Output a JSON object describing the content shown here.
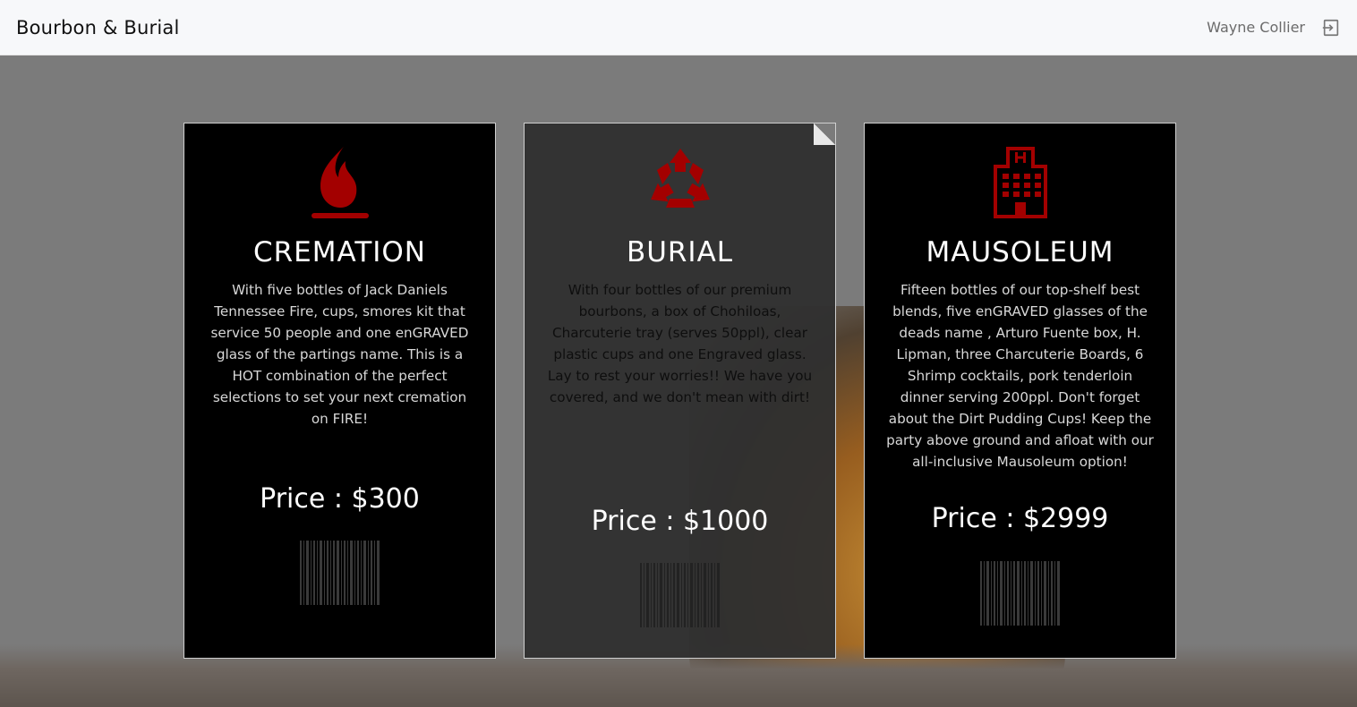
{
  "header": {
    "brand": "Bourbon & Burial",
    "user_name": "Wayne Collier",
    "logout_icon": "sign-out-icon"
  },
  "cards": [
    {
      "title": "CREMATION",
      "icon": "fire-icon",
      "description": "With five bottles of Jack Daniels Tennessee Fire, cups, smores kit that service 50 people and one enGRAVED glass of the partings name. This is a HOT combination of the perfect selections to set your next cremation on FIRE!",
      "price": "Price : $300"
    },
    {
      "title": "BURIAL",
      "icon": "recycle-icon",
      "description": "With four bottles of our premium bourbons, a box of Chohiloas, Charcuterie tray (serves 50ppl), clear plastic cups and one Engraved glass. Lay to rest your worries!! We have you covered, and we don't mean with dirt!",
      "price": "Price : $1000"
    },
    {
      "title": "MAUSOLEUM",
      "icon": "hospital-building-icon",
      "description": "Fifteen bottles of our top-shelf best blends, five enGRAVED glasses of the deads name , Arturo Fuente box, H. Lipman, three Charcuterie Boards, 6 Shrimp cocktails, pork tenderloin dinner serving 200ppl. Don't forget about the Dirt Pudding Cups! Keep the party above ground and afloat with our all-inclusive Mausoleum option!",
      "price": "Price : $2999"
    }
  ],
  "colors": {
    "accent_red": "#a30000",
    "topbar_bg": "#f7f8fa",
    "card_bg": "#000000",
    "featured_card_bg": "#303030"
  }
}
